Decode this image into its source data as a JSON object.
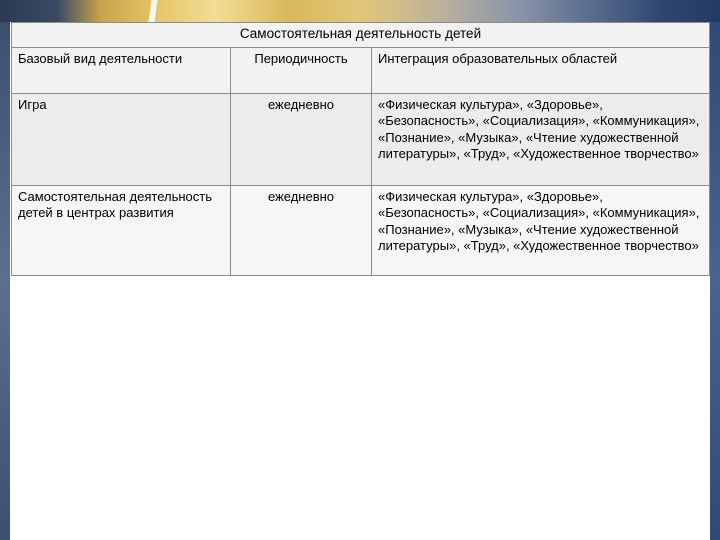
{
  "table": {
    "title": "Самостоятельная деятельность детей",
    "headers": [
      "Базовый вид деятельности",
      "Периодичность",
      "Интеграция образовательных областей"
    ],
    "rows": [
      {
        "activity": "Игра",
        "frequency": "ежедневно",
        "integration": "«Физическая культура», «Здоровье», «Безопасность», «Социализация», «Коммуникация», «Познание», «Музыка», «Чтение художественной литературы», «Труд», «Художественное творчество»"
      },
      {
        "activity": "Самостоятельная деятельность детей в центрах развития",
        "frequency": "ежедневно",
        "integration": "«Физическая культура», «Здоровье», «Безопасность», «Социализация», «Коммуникация», «Познание», «Музыка», «Чтение художественной литературы», «Труд», «Художественное творчество»"
      }
    ]
  }
}
